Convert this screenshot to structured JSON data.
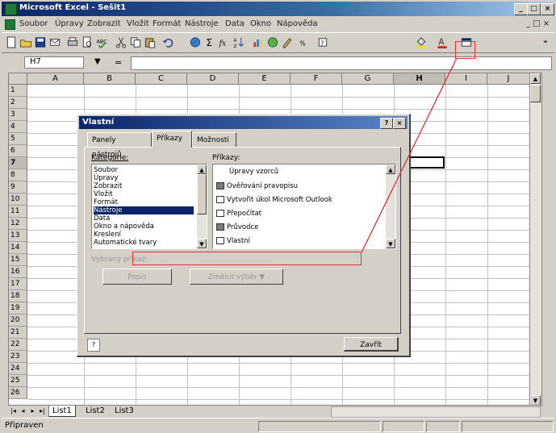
{
  "window": {
    "title": "Microsoft Excel - Sešit1",
    "min": "_",
    "max": "□",
    "close": "×"
  },
  "menu": [
    "Soubor",
    "Úpravy",
    "Zobrazit",
    "Vložit",
    "Formát",
    "Nástroje",
    "Data",
    "Okno",
    "Nápověda"
  ],
  "formula": {
    "namebox": "H7",
    "fx": "="
  },
  "columns": [
    "A",
    "B",
    "C",
    "D",
    "E",
    "F",
    "G",
    "H",
    "I",
    "J"
  ],
  "rows": [
    "1",
    "2",
    "3",
    "4",
    "5",
    "6",
    "7",
    "8",
    "9",
    "10",
    "11",
    "12",
    "13",
    "14",
    "15",
    "16",
    "17",
    "18",
    "19",
    "20",
    "21",
    "22",
    "23",
    "24",
    "25",
    "26"
  ],
  "sheets": {
    "tabs": [
      "List1",
      "List2",
      "List3"
    ],
    "active": "List1"
  },
  "status": {
    "text": "Připraven"
  },
  "dialog": {
    "title": "Vlastní",
    "help_btn": "?",
    "close_btn": "×",
    "tabs": [
      "Panely nástrojů",
      "Příkazy",
      "Možnosti"
    ],
    "active_tab": "Příkazy",
    "categories_label": "Kategorie:",
    "categories": [
      "Soubor",
      "Úpravy",
      "Zobrazit",
      "Vložit",
      "Formát",
      "Nástroje",
      "Data",
      "Okno a nápověda",
      "Kreslení",
      "Automatické tvary"
    ],
    "selected_category": "Nástroje",
    "commands_label": "Příkazy:",
    "commands": [
      "Úpravy vzorců",
      "Ověřování pravopisu",
      "Vytvořit úkol Microsoft Outlook",
      "Přepočítat",
      "Průvodce",
      "Vlastní"
    ],
    "selected_label": "Vybraný příkaz:",
    "btn_description": "Popis",
    "btn_modify": "Změnit výběr ▼",
    "btn_close": "Zavřít"
  },
  "colors": {
    "highlight": "#e0313a",
    "title_bar": "#0a246a",
    "face": "#d4d0c8"
  }
}
